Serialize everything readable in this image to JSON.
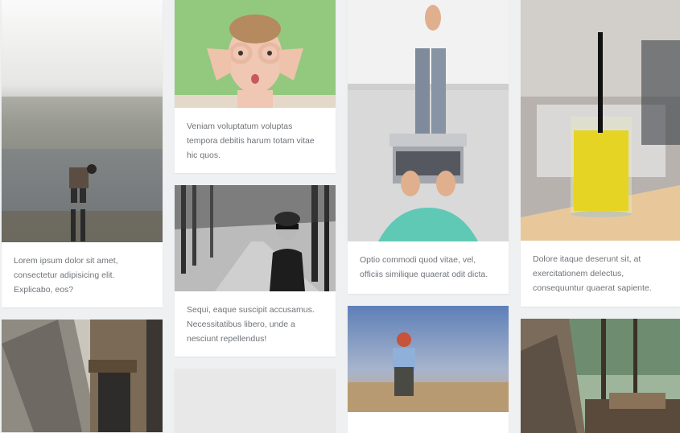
{
  "cards": [
    {
      "alt": "Person standing by a misty lake",
      "caption": "Lorem ipsum dolor sit amet, consectetur adipisicing elit. Explicabo, eos?"
    },
    {
      "alt": "Woman making goggles with fingers",
      "caption": "Veniam voluptatum voluptas tempora debitis harum totam vitae hic quos."
    },
    {
      "alt": "Woman with sunglasses in a forest path",
      "caption": "Sequi, eaque suscipit accusamus. Necessitatibus libero, unde a nesciunt repellendus!"
    },
    {
      "alt": "Person using a laptop on a couch",
      "caption": "Optio commodi quod vitae, vel, officiis similique quaerat odit dicta."
    },
    {
      "alt": "Glass of orange juice with straw",
      "caption": "Dolore itaque deserunt sit, at exercitationem delectus, consequuntur quaerat sapiente."
    },
    {
      "alt": "Worker with tool belt"
    },
    {
      "alt": "Light grey image"
    },
    {
      "alt": "Woman with backpack looking at landscape"
    },
    {
      "alt": "Stacked firewood in a forest"
    }
  ]
}
